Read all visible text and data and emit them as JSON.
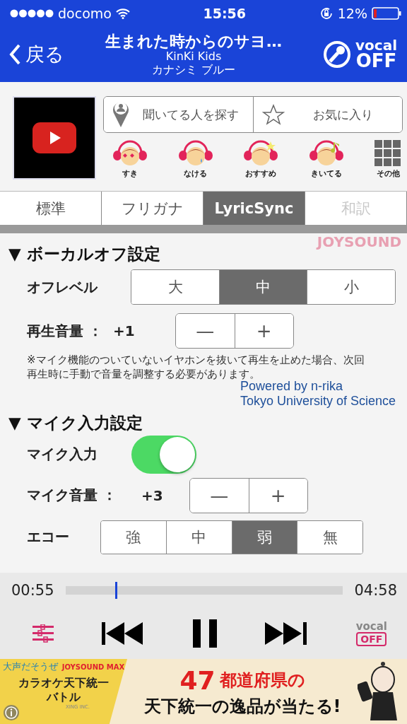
{
  "status_bar": {
    "carrier": "docomo",
    "time": "15:56",
    "battery": "12%"
  },
  "nav": {
    "back": "戻る",
    "title": "生まれた時からのサヨ…",
    "artist": "KinKi Kids",
    "subtitle": "カナシミ ブルー",
    "vocal_top": "vocal",
    "vocal_bottom": "OFF"
  },
  "actions": [
    {
      "kind": "person",
      "label": "聞いてる人を探す"
    },
    {
      "kind": "star",
      "label": "お気に入り"
    }
  ],
  "reactions": [
    {
      "kind": "love",
      "label": "すき"
    },
    {
      "kind": "cry",
      "label": "なける"
    },
    {
      "kind": "star",
      "label": "おすすめ"
    },
    {
      "kind": "music",
      "label": "きいてる"
    },
    {
      "kind": "grid",
      "label": "その他"
    }
  ],
  "tabs": [
    {
      "label": "標準",
      "selected": false,
      "disabled": false
    },
    {
      "label": "フリガナ",
      "selected": false,
      "disabled": false
    },
    {
      "label": "LyricSync",
      "selected": true,
      "disabled": false
    },
    {
      "label": "和訳",
      "selected": false,
      "disabled": true
    }
  ],
  "brand": "JOYSOUND",
  "vocal_off": {
    "heading": "▼ ボーカルオフ設定",
    "off_level_label": "オフレベル",
    "off_levels": [
      {
        "label": "大",
        "selected": false
      },
      {
        "label": "中",
        "selected": true
      },
      {
        "label": "小",
        "selected": false
      }
    ],
    "volume_label": "再生音量 ：",
    "volume_value": "+1",
    "minus": "—",
    "plus": "+",
    "note": "※マイク機能のついていないイヤホンを抜いて再生を止めた場合、次回再生時に手動で音量を調整する必要があります。",
    "credit_1": "Powered by n-rika",
    "credit_2": "Tokyo University of Science"
  },
  "mic": {
    "heading": "▼ マイク入力設定",
    "input_label": "マイク入力",
    "input_on": true,
    "volume_label": "マイク音量 ：",
    "volume_value": "+3",
    "minus": "—",
    "plus": "+",
    "echo_label": "エコー",
    "echo_levels": [
      {
        "label": "強",
        "selected": false
      },
      {
        "label": "中",
        "selected": false
      },
      {
        "label": "弱",
        "selected": true
      },
      {
        "label": "無",
        "selected": false
      }
    ]
  },
  "player": {
    "elapsed": "00:55",
    "total": "04:58",
    "level": 0.18,
    "vocal_top": "vocal",
    "vocal_bottom": "OFF"
  },
  "ad": {
    "tagline": "大声だそうぜ",
    "brand": "JOYSOUND MAX",
    "campaign": "カラオケ天下統一バトル",
    "number": "47",
    "headline": "都道府県の",
    "subline": "天下統一の逸品が当たる!",
    "company": "XING INC."
  }
}
